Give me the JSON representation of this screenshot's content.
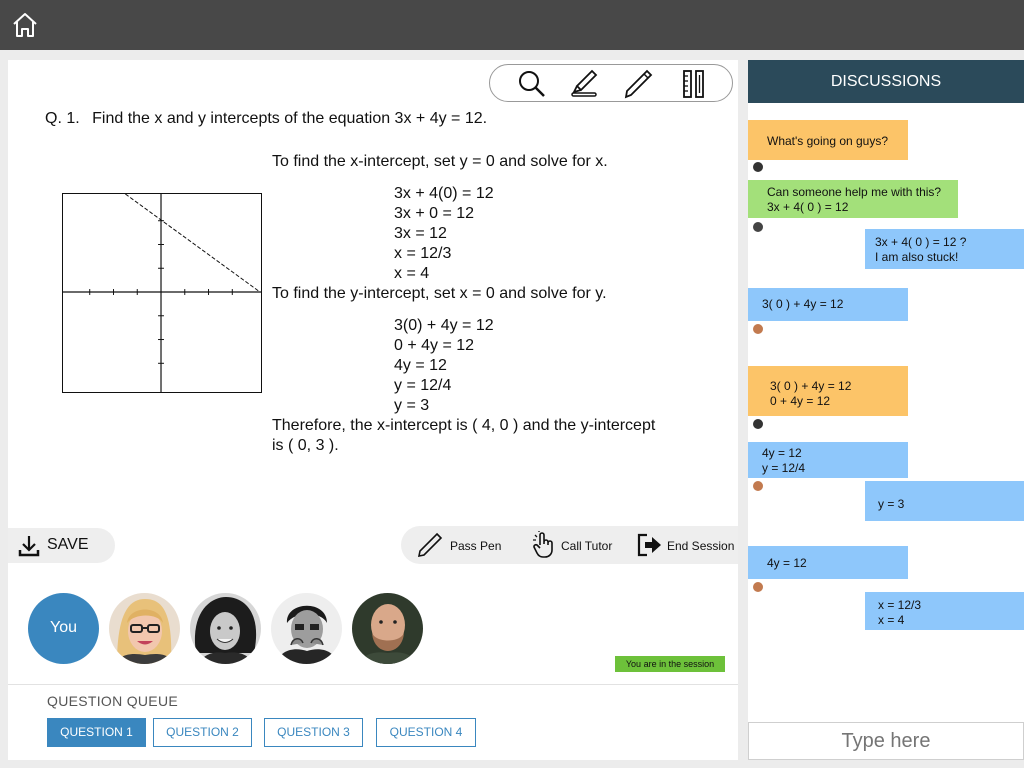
{
  "main": {
    "question_number": "Q. 1.",
    "question_text": "Find the x and y intercepts of the equation 3x + 4y = 12.",
    "x_intro": "To find the x-intercept, set y = 0 and solve for x.",
    "x_steps": [
      "3x + 4(0) = 12",
      "3x + 0 = 12",
      "3x = 12",
      "x = 12/3",
      "x = 4"
    ],
    "y_intro": "To find the y-intercept, set x = 0 and solve for y.",
    "y_steps": [
      "3(0) + 4y = 12",
      "0 + 4y = 12",
      "4y = 12",
      "y = 12/4",
      "y = 3"
    ],
    "conclusion_1": "Therefore, the x-intercept is ( 4, 0 ) and the y-intercept",
    "conclusion_2": "is ( 0, 3 )."
  },
  "toolbar": {
    "icons": [
      "search-icon",
      "highlighter-icon",
      "pen-icon",
      "ruler-icon"
    ]
  },
  "actions": {
    "save_label": "SAVE",
    "pass_pen_label": "Pass Pen",
    "call_tutor_label": "Call Tutor",
    "end_session_label": "End Session"
  },
  "participants": {
    "you_label": "You",
    "session_badge": "You are in the session"
  },
  "queue": {
    "title": "QUESTION QUEUE",
    "items": [
      "QUESTION 1",
      "QUESTION 2",
      "QUESTION 3",
      "QUESTION 4"
    ],
    "active_index": 0
  },
  "discussions": {
    "title": "DISCUSSIONS",
    "messages": [
      {
        "text": "What's going on guys?",
        "color": "#fcc468"
      },
      {
        "text": "Can someone help me with this?\n3x + 4( 0 ) = 12",
        "color": "#a3e07a"
      },
      {
        "text": "3x + 4( 0 ) = 12 ?\nI am also stuck!",
        "color": "#8ec7fb"
      },
      {
        "text": "3( 0 ) + 4y = 12",
        "color": "#8ec7fb"
      },
      {
        "text": "3( 0 ) + 4y = 12\n0 + 4y = 12",
        "color": "#fcc468"
      },
      {
        "text": "4y = 12\ny = 12/4",
        "color": "#8ec7fb"
      },
      {
        "text": "y = 3",
        "color": "#8ec7fb"
      },
      {
        "text": "4y = 12",
        "color": "#8ec7fb"
      },
      {
        "text": "x = 12/3\nx = 4",
        "color": "#8ec7fb"
      }
    ],
    "input_placeholder": "Type here"
  },
  "colors": {
    "topbar": "#484848",
    "accent_blue": "#3a87bf",
    "discussion_header": "#2b4a5a",
    "badge_green": "#6dc13a"
  }
}
